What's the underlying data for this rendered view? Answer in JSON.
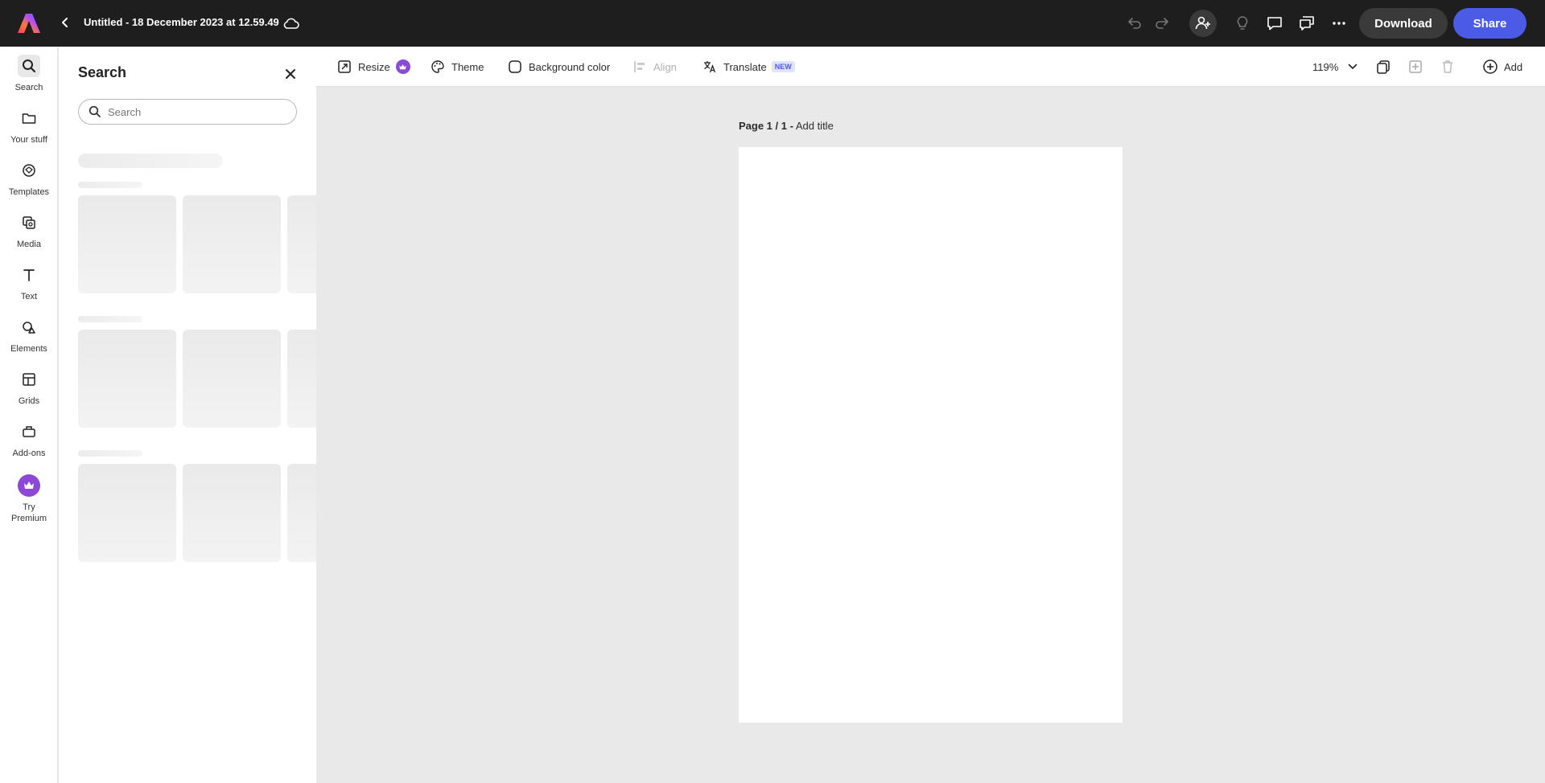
{
  "header": {
    "document_title": "Untitled - 18 December 2023 at 12.59.49",
    "download_label": "Download",
    "share_label": "Share"
  },
  "rail": {
    "items": [
      {
        "label": "Search",
        "icon": "search-icon"
      },
      {
        "label": "Your stuff",
        "icon": "folder-icon"
      },
      {
        "label": "Templates",
        "icon": "templates-icon"
      },
      {
        "label": "Media",
        "icon": "media-icon"
      },
      {
        "label": "Text",
        "icon": "text-icon"
      },
      {
        "label": "Elements",
        "icon": "shapes-icon"
      },
      {
        "label": "Grids",
        "icon": "grid-icon"
      },
      {
        "label": "Add-ons",
        "icon": "addons-icon"
      },
      {
        "label_line1": "Try",
        "label_line2": "Premium",
        "icon": "crown-icon"
      }
    ]
  },
  "panel": {
    "title": "Search",
    "search_placeholder": "Search"
  },
  "toolbar": {
    "resize_label": "Resize",
    "theme_label": "Theme",
    "background_label": "Background color",
    "align_label": "Align",
    "translate_label": "Translate",
    "translate_badge": "NEW",
    "zoom_level": "119%",
    "add_label": "Add"
  },
  "canvas": {
    "page_indicator": "Page 1 / 1 -",
    "page_title_placeholder": "Add title"
  },
  "colors": {
    "accent": "#4b5be6",
    "premium": "#8c49d8",
    "topbar": "#1e1e1e",
    "canvas_bg": "#e9e9e9"
  }
}
